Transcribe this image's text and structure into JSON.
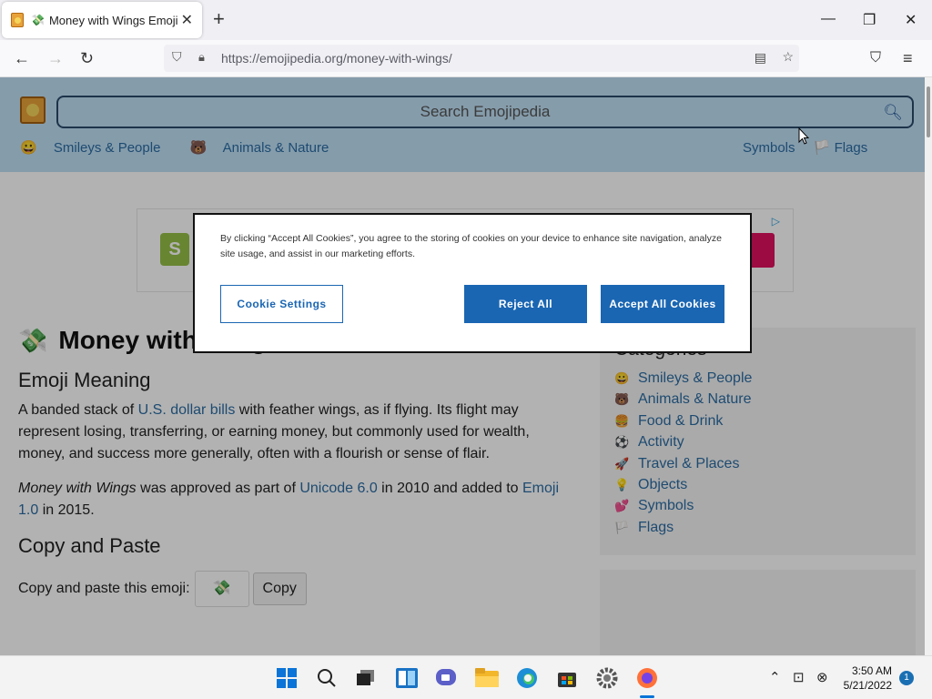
{
  "browser": {
    "tab_title": "Money with Wings Emoji",
    "tab_emoji": "💸",
    "new_tab": "+",
    "url_host": "https://emojipedia.org",
    "url_path": "/money-with-wings/"
  },
  "site": {
    "search_placeholder": "Search Emojipedia",
    "nav": [
      {
        "icon": "😀",
        "label": "Smileys & People"
      },
      {
        "icon": "🐻",
        "label": "Animals & Nature"
      },
      {
        "label": "Symbols"
      },
      {
        "icon": "🏳️",
        "label": "Flags"
      }
    ]
  },
  "main": {
    "emoji": "💸",
    "title": "Money with Wings",
    "meaning_heading": "Emoji Meaning",
    "meaning_p1_a": "A banded stack of ",
    "meaning_p1_link": "U.S. dollar bills",
    "meaning_p1_b": " with feather wings, as if flying. Its flight may represent losing, transferring, or earning money, but commonly used for wealth, money, and success more generally, often with a flourish or sense of flair.",
    "meaning_p2_em": "Money with Wings",
    "meaning_p2_a": " was approved as part of ",
    "meaning_p2_link1": "Unicode 6.0",
    "meaning_p2_b": " in 2010 and added to ",
    "meaning_p2_link2": "Emoji 1.0",
    "meaning_p2_c": " in 2015.",
    "copy_heading": "Copy and Paste",
    "copy_label": "Copy and paste this emoji:",
    "copy_button": "Copy"
  },
  "sidebar": {
    "title": "Categories",
    "items": [
      {
        "icon": "😀",
        "label": "Smileys & People"
      },
      {
        "icon": "🐻",
        "label": "Animals & Nature"
      },
      {
        "icon": "🍔",
        "label": "Food & Drink"
      },
      {
        "icon": "⚽",
        "label": "Activity"
      },
      {
        "icon": "🚀",
        "label": "Travel & Places"
      },
      {
        "icon": "💡",
        "label": "Objects"
      },
      {
        "icon": "💕",
        "label": "Symbols"
      },
      {
        "icon": "🏳️",
        "label": "Flags"
      }
    ]
  },
  "cookie_banner": {
    "text": "By clicking “Accept All Cookies”, you agree to the storing of cookies on your device to enhance site navigation, analyze site usage, and assist in our marketing efforts.",
    "settings_button": "Cookie Settings",
    "reject_button": "Reject All",
    "accept_button": "Accept All Cookies"
  },
  "taskbar": {
    "time": "3:50 AM",
    "date": "5/21/2022",
    "notification_count": "1"
  },
  "colors": {
    "accent": "#1a66b3",
    "header_bg": "#bfe0f5",
    "link": "#2b6ca3"
  }
}
